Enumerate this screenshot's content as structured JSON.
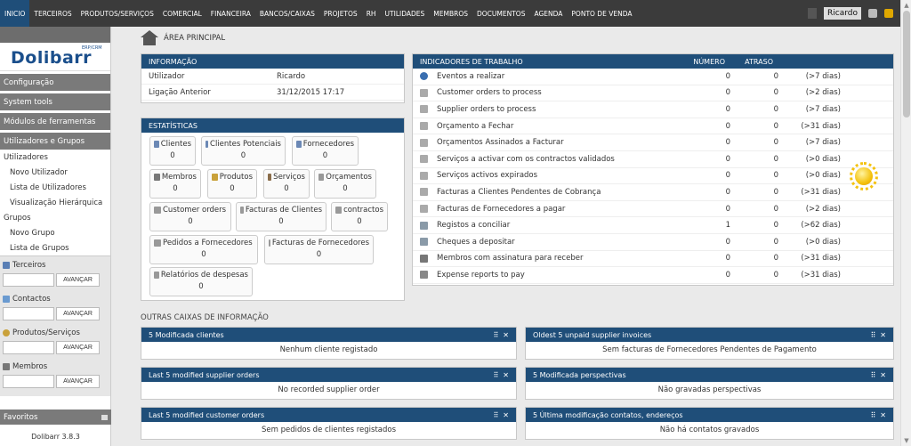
{
  "topnav": {
    "tabs": [
      "INICIO",
      "TERCEIROS",
      "PRODUTOS/SERVIÇOS",
      "COMERCIAL",
      "FINANCEIRA",
      "BANCOS/CAIXAS",
      "PROJETOS",
      "RH",
      "UTILIDADES",
      "MEMBROS",
      "DOCUMENTOS",
      "AGENDA",
      "PONTO DE VENDA"
    ],
    "user": "Ricardo"
  },
  "sidebar": {
    "logo": "Dolibarr",
    "logo_sub": "ERP/CRM",
    "config": "Configuração",
    "system_tools": "System tools",
    "modules": "Módulos de ferramentas",
    "users_groups": "Utilizadores e Grupos",
    "links": [
      "Utilizadores",
      "Novo Utilizador",
      "Lista de Utilizadores",
      "Visualização Hierárquica",
      "Grupos",
      "Novo Grupo",
      "Lista de Grupos"
    ],
    "searches": [
      {
        "label": "Terceiros",
        "button": "AVANÇAR"
      },
      {
        "label": "Contactos",
        "button": "AVANÇAR"
      },
      {
        "label": "Produtos/Serviços",
        "button": "AVANÇAR"
      },
      {
        "label": "Membros",
        "button": "AVANÇAR"
      }
    ],
    "favoritos": "Favoritos",
    "version": "Dolibarr 3.8.3"
  },
  "main": {
    "title": "ÁREA PRINCIPAL",
    "info": {
      "title": "INFORMAÇÃO",
      "rows": [
        {
          "k": "Utilizador",
          "v": "Ricardo"
        },
        {
          "k": "Ligação Anterior",
          "v": "31/12/2015 17:17"
        }
      ]
    },
    "stats": {
      "title": "ESTATÍSTICAS",
      "items": [
        {
          "label": "Clientes",
          "value": "0"
        },
        {
          "label": "Clientes Potenciais",
          "value": "0"
        },
        {
          "label": "Fornecedores",
          "value": "0"
        },
        {
          "label": "Membros",
          "value": "0"
        },
        {
          "label": "Produtos",
          "value": "0"
        },
        {
          "label": "Serviços",
          "value": "0"
        },
        {
          "label": "Orçamentos",
          "value": "0"
        },
        {
          "label": "Customer orders",
          "value": "0"
        },
        {
          "label": "Facturas de Clientes",
          "value": "0"
        },
        {
          "label": "contractos",
          "value": "0"
        },
        {
          "label": "Pedidos a Fornecedores",
          "value": "0"
        },
        {
          "label": "Facturas de Fornecedores",
          "value": "0"
        },
        {
          "label": "Relatórios de despesas",
          "value": "0"
        }
      ]
    },
    "indicators": {
      "title": "INDICADORES DE TRABALHO",
      "col_num": "NÚMERO",
      "col_late": "ATRASO",
      "rows": [
        {
          "t": "Eventos a realizar",
          "n": "0",
          "a": "0",
          "d": "(>7 dias)"
        },
        {
          "t": "Customer orders to process",
          "n": "0",
          "a": "0",
          "d": "(>2 dias)"
        },
        {
          "t": "Supplier orders to process",
          "n": "0",
          "a": "0",
          "d": "(>7 dias)"
        },
        {
          "t": "Orçamento a Fechar",
          "n": "0",
          "a": "0",
          "d": "(>31 dias)"
        },
        {
          "t": "Orçamentos Assinados a Facturar",
          "n": "0",
          "a": "0",
          "d": "(>7 dias)"
        },
        {
          "t": "Serviços a activar com os contractos validados",
          "n": "0",
          "a": "0",
          "d": "(>0 dias)"
        },
        {
          "t": "Serviços activos expirados",
          "n": "0",
          "a": "0",
          "d": "(>0 dias)"
        },
        {
          "t": "Facturas a Clientes Pendentes de Cobrança",
          "n": "0",
          "a": "0",
          "d": "(>31 dias)"
        },
        {
          "t": "Facturas de Fornecedores a pagar",
          "n": "0",
          "a": "0",
          "d": "(>2 dias)"
        },
        {
          "t": "Registos a conciliar",
          "n": "1",
          "a": "0",
          "d": "(>62 dias)"
        },
        {
          "t": "Cheques a depositar",
          "n": "0",
          "a": "0",
          "d": "(>0 dias)"
        },
        {
          "t": "Membros com assinatura para receber",
          "n": "0",
          "a": "0",
          "d": "(>31 dias)"
        },
        {
          "t": "Expense reports to pay",
          "n": "0",
          "a": "0",
          "d": "(>31 dias)"
        }
      ]
    },
    "outras_title": "OUTRAS CAIXAS DE INFORMAÇÃO",
    "boxes": [
      {
        "title": "5 Modificada clientes",
        "body": "Nenhum cliente registado"
      },
      {
        "title": "Oldest 5 unpaid supplier invoices",
        "body": "Sem facturas de Fornecedores Pendentes de Pagamento"
      },
      {
        "title": "Last 5 modified supplier orders",
        "body": "No recorded supplier order"
      },
      {
        "title": "5 Modificada perspectivas",
        "body": "Não gravadas perspectivas"
      },
      {
        "title": "Last 5 modified customer orders",
        "body": "Sem pedidos de clientes registados"
      },
      {
        "title": "5 Última modificação contatos, endereços",
        "body": "Não há contatos gravados"
      }
    ]
  },
  "colors": {
    "nav": "#3b3b3b",
    "accent": "#1f4e79",
    "side_head": "#7a7a7a"
  }
}
